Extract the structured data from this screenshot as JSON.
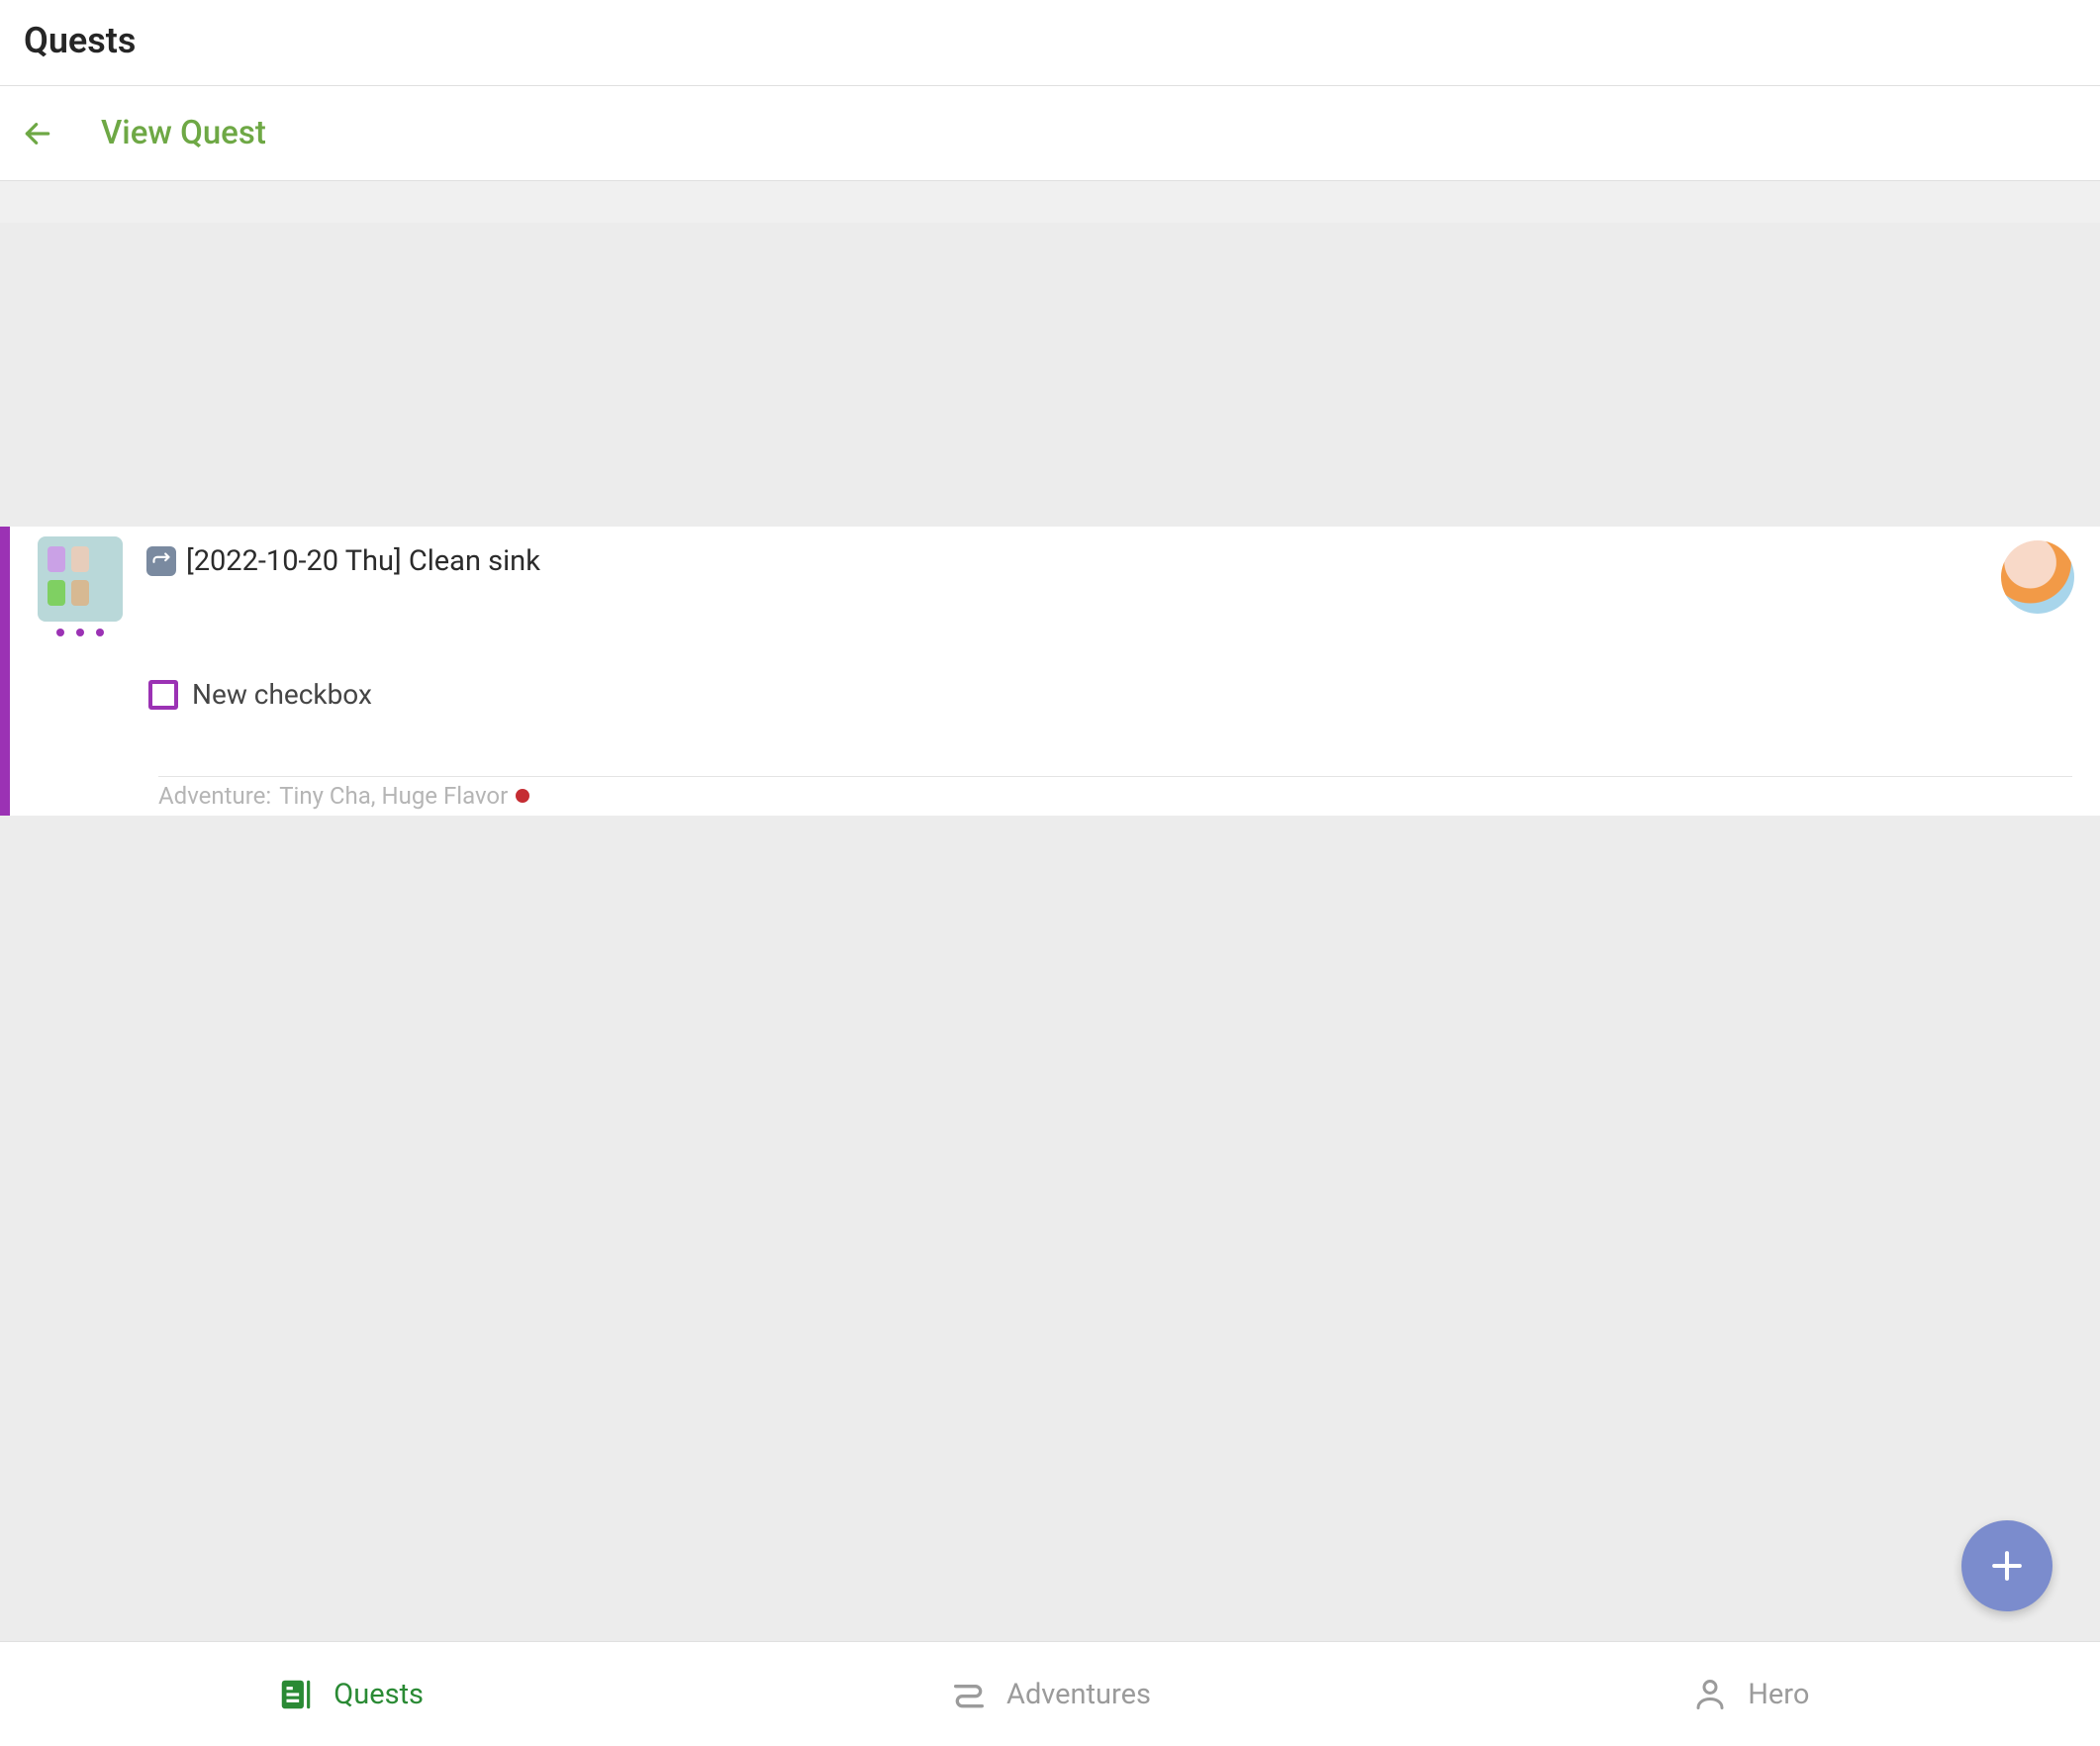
{
  "header": {
    "title": "Quests"
  },
  "subheader": {
    "title": "View Quest"
  },
  "quest": {
    "title": "[2022-10-20 Thu] Clean sink",
    "checkbox_label": "New checkbox",
    "adventure_prefix": "Adventure: ",
    "adventure_name": "Tiny Cha, Huge Flavor",
    "accent_color": "#9b32b4"
  },
  "nav": {
    "items": [
      {
        "label": "Quests",
        "active": true
      },
      {
        "label": "Adventures",
        "active": false
      },
      {
        "label": "Hero",
        "active": false
      }
    ]
  }
}
